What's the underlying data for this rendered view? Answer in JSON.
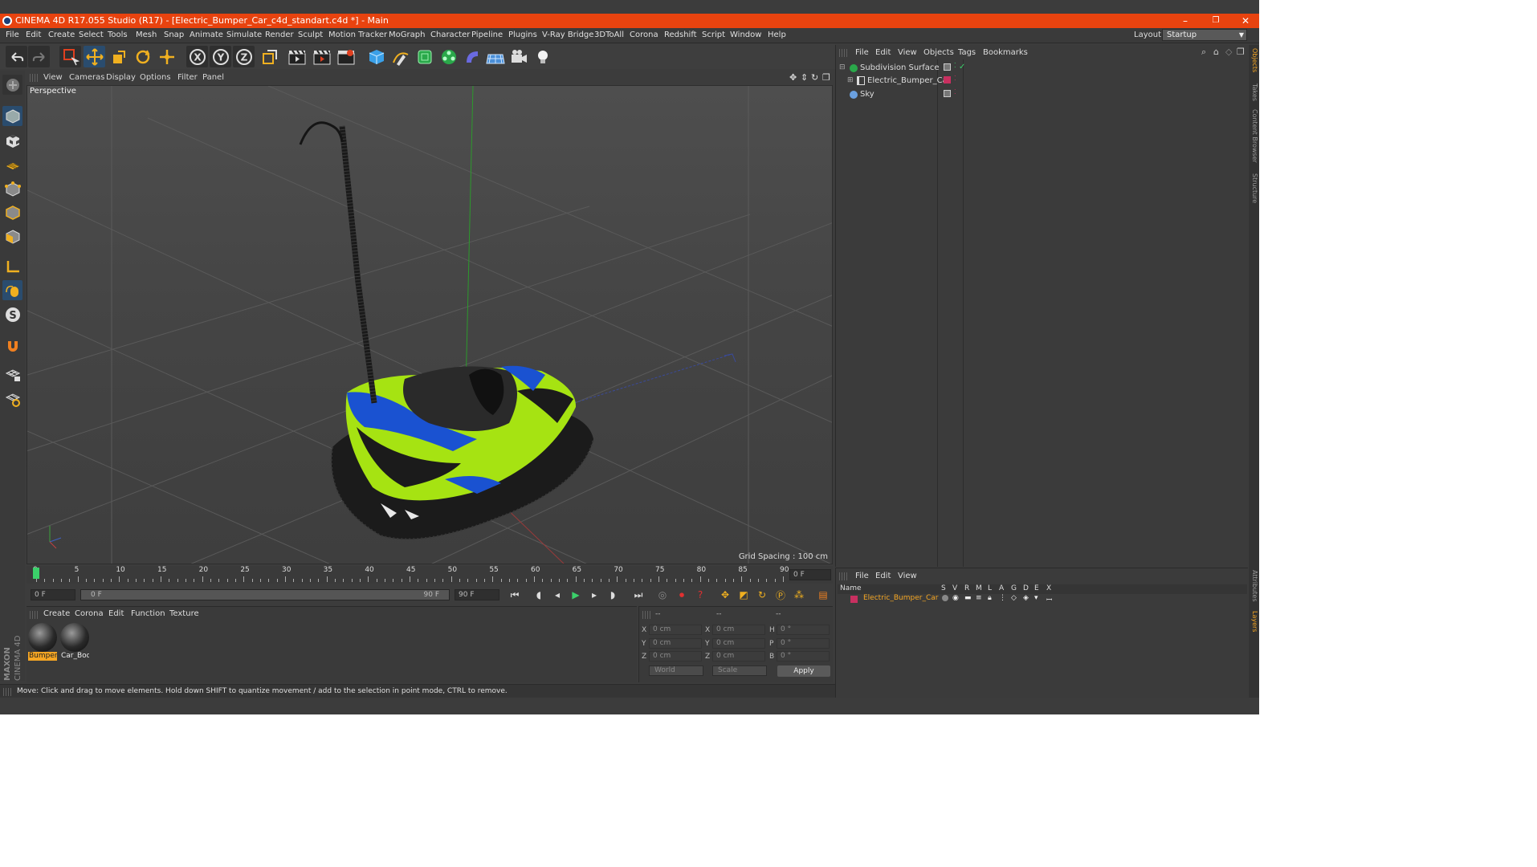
{
  "titlebar": {
    "title": "CINEMA 4D R17.055 Studio (R17) - [Electric_Bumper_Car_c4d_standart.c4d *] - Main",
    "minimize": "–",
    "restore": "❐",
    "close": "✕"
  },
  "menu": [
    "File",
    "Edit",
    "Create",
    "Select",
    "Tools",
    "Mesh",
    "Snap",
    "Animate",
    "Simulate",
    "Render",
    "Sculpt",
    "Motion Tracker",
    "MoGraph",
    "Character",
    "Pipeline",
    "Plugins",
    "V-Ray Bridge",
    "3DToAll",
    "Corona",
    "Redshift",
    "Script",
    "Window",
    "Help"
  ],
  "layout": {
    "label": "Layout:",
    "value": "Startup"
  },
  "viewport_menu": [
    "View",
    "Cameras",
    "Display",
    "Options",
    "Filter",
    "Panel"
  ],
  "viewport": {
    "label": "Perspective",
    "grid_spacing": "Grid Spacing : 100 cm"
  },
  "timeline": {
    "ticks": [
      "0",
      "5",
      "10",
      "15",
      "20",
      "25",
      "30",
      "35",
      "40",
      "45",
      "50",
      "55",
      "60",
      "65",
      "70",
      "75",
      "80",
      "85",
      "90"
    ],
    "current_frame": "0 F"
  },
  "transport": {
    "start": "0 F",
    "range_start": "0 F",
    "range_end": "90 F",
    "end": "90 F"
  },
  "materials": {
    "menu": [
      "Create",
      "Corona",
      "Edit",
      "Function",
      "Texture"
    ],
    "items": [
      {
        "name": "Bumper",
        "selected": true
      },
      {
        "name": "Car_Bod",
        "selected": false
      }
    ]
  },
  "coordinates": {
    "headers": [
      "--",
      "--",
      "--"
    ],
    "rows": [
      {
        "a": "X",
        "av": "0 cm",
        "b": "X",
        "bv": "0 cm",
        "c": "H",
        "cv": "0 °"
      },
      {
        "a": "Y",
        "av": "0 cm",
        "b": "Y",
        "bv": "0 cm",
        "c": "P",
        "cv": "0 °"
      },
      {
        "a": "Z",
        "av": "0 cm",
        "b": "Z",
        "bv": "0 cm",
        "c": "B",
        "cv": "0 °"
      }
    ],
    "space": "World",
    "mode": "Scale",
    "apply": "Apply"
  },
  "brand": {
    "line1": "MAXON",
    "line2": "CINEMA 4D"
  },
  "status": "Move: Click and drag to move elements. Hold down SHIFT to quantize movement / add to the selection in point mode, CTRL to remove.",
  "object_manager": {
    "menu": [
      "File",
      "Edit",
      "View",
      "Objects",
      "Tags",
      "Bookmarks"
    ],
    "objects": [
      {
        "name": "Subdivision Surface",
        "indent": 0,
        "icon": "subdivision-icon"
      },
      {
        "name": "Electric_Bumper_Car",
        "indent": 1,
        "icon": "null-icon"
      },
      {
        "name": "Sky",
        "indent": 0,
        "icon": "sky-icon"
      }
    ]
  },
  "attribute_manager": {
    "menu": [
      "File",
      "Edit",
      "View"
    ],
    "columns": [
      "Name",
      "S",
      "V",
      "R",
      "M",
      "L",
      "A",
      "G",
      "D",
      "E",
      "X"
    ],
    "row": "Electric_Bumper_Car"
  },
  "right_tabs": [
    "Objects",
    "Takes",
    "Content Browser",
    "Structure",
    "Attributes",
    "Layers"
  ],
  "colors": {
    "accent": "#e8430f",
    "selection": "#f5a623",
    "car_green": "#a6e312",
    "car_blue": "#1a52d1"
  }
}
